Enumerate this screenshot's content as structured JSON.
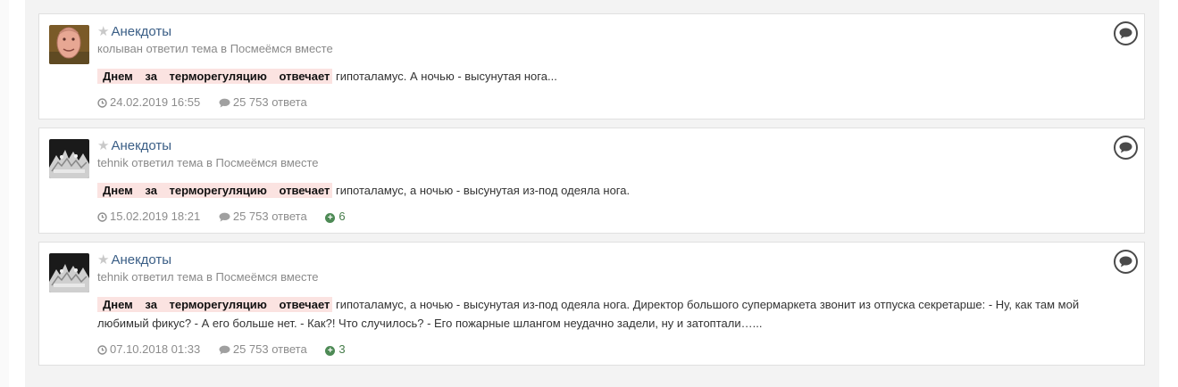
{
  "results": [
    {
      "title": "Анекдоты",
      "meta": "колыван ответил тема в Посмеёмся вместе",
      "highlight": "Днем за терморегуляцию отвечает",
      "snippet": " гипоталамус. А ночью - высунутая нога...",
      "date": "24.02.2019 16:55",
      "replies": "25 753 ответа",
      "reputation": "",
      "avatar": "cartoon-face"
    },
    {
      "title": "Анекдоты",
      "meta": "tehnik ответил тема в Посмеёмся вместе",
      "highlight": "Днем за терморегуляцию отвечает",
      "snippet": " гипоталамус, а ночью - высунутая из-под одеяла нога.",
      "date": "15.02.2019 18:21",
      "replies": "25 753 ответа",
      "reputation": "6",
      "avatar": "dark-photo"
    },
    {
      "title": "Анекдоты",
      "meta": "tehnik ответил тема в Посмеёмся вместе",
      "highlight": "Днем за терморегуляцию отвечает",
      "snippet": " гипоталамус, а ночью - высунутая из-под одеяла нога. Директор большого супермаркета звонит из отпуска секретарше: - Ну, как там мой любимый фикус? - А его больше нет. - Как?! Что случилось? - Его пожарные шлангом неудачно задели, ну и затоптали…...",
      "date": "07.10.2018 01:33",
      "replies": "25 753 ответа",
      "reputation": "3",
      "avatar": "dark-photo"
    }
  ],
  "colors": {
    "link": "#3a5e86",
    "highlight_bg": "#fbe3e1",
    "reputation": "#467c4a"
  }
}
